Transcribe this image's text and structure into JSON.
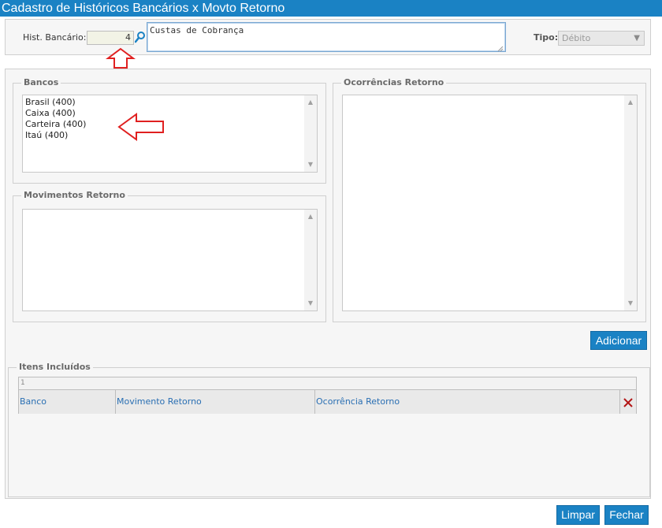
{
  "window": {
    "title": "Cadastro de Históricos Bancários x Movto Retorno"
  },
  "header": {
    "hist_label": "Hist. Bancário:",
    "hist_code": "4",
    "description": "Custas de Cobrança",
    "tipo_label": "Tipo:",
    "tipo_value": "Débito"
  },
  "bancos": {
    "legend": "Bancos",
    "items": [
      "Brasil (400)",
      "Caixa (400)",
      "Carteira (400)",
      "Itaú (400)"
    ]
  },
  "movimentos": {
    "legend": "Movimentos Retorno"
  },
  "ocorrencias": {
    "legend": "Ocorrências Retorno"
  },
  "buttons": {
    "adicionar": "Adicionar",
    "limpar": "Limpar",
    "fechar": "Fechar"
  },
  "itens": {
    "legend": "Itens Incluídos",
    "page_indicator": "1",
    "columns": [
      "Banco",
      "Movimento Retorno",
      "Ocorrência Retorno"
    ]
  },
  "colors": {
    "accent": "#1a82c4",
    "annotation": "#e02020",
    "delete": "#b31515"
  }
}
